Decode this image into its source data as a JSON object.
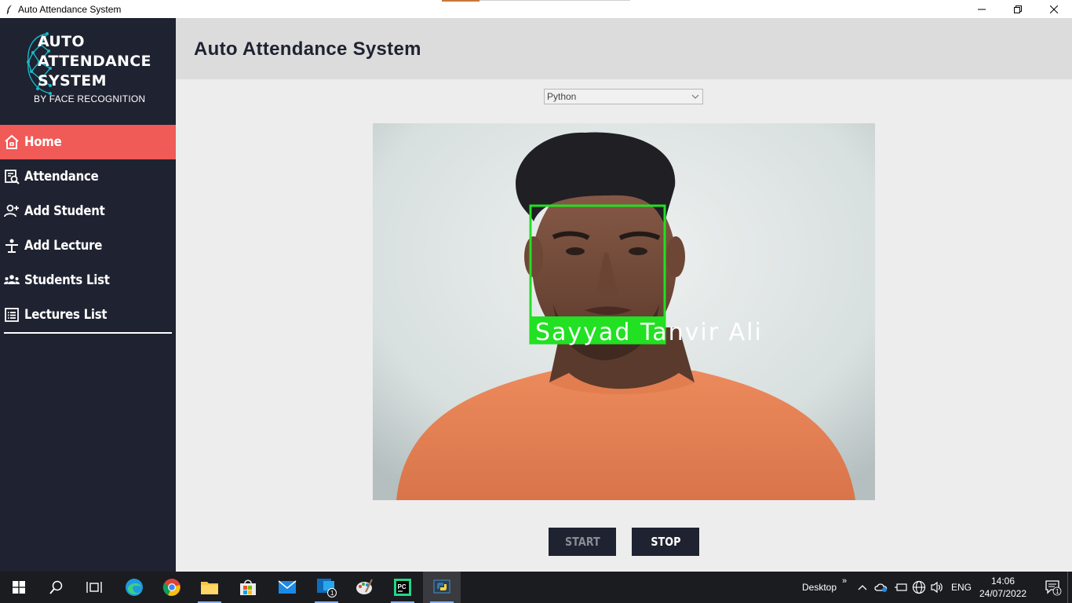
{
  "window": {
    "title": "Auto Attendance System"
  },
  "logo": {
    "line1": "AUTO",
    "line2": "ATTENDANCE",
    "line3": "SYSTEM",
    "subtitle": "BY FACE RECOGNITION"
  },
  "sidebar": {
    "items": [
      {
        "label": "Home",
        "icon": "home-icon",
        "active": true
      },
      {
        "label": "Attendance",
        "icon": "attendance-search-icon",
        "active": false
      },
      {
        "label": "Add Student",
        "icon": "add-user-icon",
        "active": false
      },
      {
        "label": "Add Lecture",
        "icon": "lecturer-desk-icon",
        "active": false
      },
      {
        "label": "Students List",
        "icon": "group-icon",
        "active": false
      },
      {
        "label": "Lectures List",
        "icon": "list-icon",
        "active": false
      }
    ]
  },
  "header": {
    "title": "Auto Attendance System"
  },
  "main": {
    "subject_select": {
      "value": "Python"
    },
    "camera": {
      "detected_name": "Sayyad Tanvir Ali"
    },
    "start_label": "START",
    "stop_label": "STOP"
  },
  "taskbar": {
    "desktop_label": "Desktop",
    "language": "ENG",
    "time": "14:06",
    "date": "24/07/2022",
    "mail_badge": "1",
    "notification_badge": "1"
  },
  "colors": {
    "sidebar_bg": "#1f2230",
    "active_item": "#f05a57",
    "detection_box": "#22e022"
  }
}
